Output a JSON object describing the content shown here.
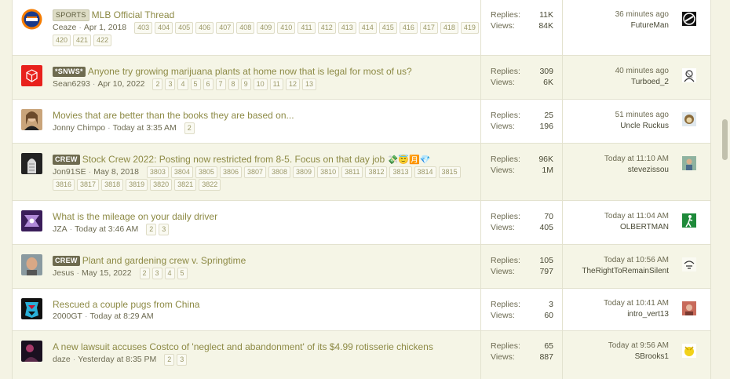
{
  "labels": {
    "replies": "Replies:",
    "views": "Views:"
  },
  "threads": [
    {
      "prefix": "SPORTS",
      "prefix_style": "sports",
      "title": "MLB Official Thread",
      "author": "Ceaze",
      "date": "Apr 1, 2018",
      "pages": [
        "403",
        "404",
        "405",
        "406",
        "407",
        "408",
        "409",
        "410",
        "411",
        "412",
        "413",
        "414",
        "415",
        "416",
        "417",
        "418",
        "419"
      ],
      "pages2": [
        "420",
        "421",
        "422"
      ],
      "replies": "11K",
      "views": "84K",
      "last_time": "36 minutes ago",
      "last_user": "FutureMan",
      "avatar_icon": "mets-logo-icon",
      "last_avatar_icon": "circle-logo-icon"
    },
    {
      "prefix": "*SNWS*",
      "prefix_style": "dark",
      "title": "Anyone try growing marijuana plants at home now that is legal for most of us?",
      "author": "Sean6293",
      "date": "Apr 10, 2022",
      "pages": [
        "2",
        "3",
        "4",
        "5",
        "6",
        "7",
        "8",
        "9",
        "10",
        "11",
        "12",
        "13"
      ],
      "pages2": [],
      "replies": "309",
      "views": "6K",
      "last_time": "40 minutes ago",
      "last_user": "Turboed_2",
      "avatar_icon": "red-cube-icon",
      "last_avatar_icon": "sketch-avatar-icon"
    },
    {
      "prefix": "",
      "prefix_style": "",
      "title": "Movies that are better than the books they are based on...",
      "author": "Jonny Chimpo",
      "date": "Today at 3:35 AM",
      "pages": [
        "2"
      ],
      "pages2": [],
      "replies": "25",
      "views": "196",
      "last_time": "51 minutes ago",
      "last_user": "Uncle Ruckus",
      "avatar_icon": "person-photo-icon",
      "last_avatar_icon": "cartoon-face-icon"
    },
    {
      "prefix": "CREW",
      "prefix_style": "dark",
      "title": "Stock Crew 2022: Posting now restricted from 8-5. Focus on that day job",
      "emoji": "💸😇🈷️💎",
      "author": "Jon91SE",
      "date": "May 8, 2018",
      "pages": [
        "3803",
        "3804",
        "3805",
        "3806",
        "3807",
        "3808",
        "3809",
        "3810",
        "3811",
        "3812",
        "3813",
        "3814",
        "3815"
      ],
      "pages2": [
        "3816",
        "3817",
        "3818",
        "3819",
        "3820",
        "3821",
        "3822"
      ],
      "replies": "96K",
      "views": "1M",
      "last_time": "Today at 11:10 AM",
      "last_user": "stevezissou",
      "avatar_icon": "statue-photo-icon",
      "last_avatar_icon": "person-photo-icon"
    },
    {
      "prefix": "",
      "prefix_style": "",
      "title": "What is the mileage on your daily driver",
      "author": "JZA",
      "date": "Today at 3:46 AM",
      "pages": [
        "2",
        "3"
      ],
      "pages2": [],
      "replies": "70",
      "views": "405",
      "last_time": "Today at 11:04 AM",
      "last_user": "OLBERTMAN",
      "avatar_icon": "purple-logo-icon",
      "last_avatar_icon": "green-figure-icon"
    },
    {
      "prefix": "CREW",
      "prefix_style": "dark",
      "title": "Plant and gardening crew v. Springtime",
      "author": "Jesus",
      "date": "May 15, 2022",
      "pages": [
        "2",
        "3",
        "4",
        "5"
      ],
      "pages2": [],
      "replies": "105",
      "views": "797",
      "last_time": "Today at 10:56 AM",
      "last_user": "TheRightToRemainSilent",
      "avatar_icon": "man-photo-icon",
      "last_avatar_icon": "sketch-avatar-icon"
    },
    {
      "prefix": "",
      "prefix_style": "",
      "title": "Rescued a couple pugs from China",
      "author": "2000GT",
      "date": "Today at 8:29 AM",
      "pages": [],
      "pages2": [],
      "replies": "3",
      "views": "60",
      "last_time": "Today at 10:41 AM",
      "last_user": "intro_vert13",
      "avatar_icon": "transformer-logo-icon",
      "last_avatar_icon": "person-photo-icon"
    },
    {
      "prefix": "",
      "prefix_style": "",
      "title": "A new lawsuit accuses Costco of 'neglect and abandonment' of its $4.99 rotisserie chickens",
      "author": "daze",
      "date": "Yesterday at 8:35 PM",
      "pages": [
        "2",
        "3"
      ],
      "pages2": [],
      "replies": "65",
      "views": "887",
      "last_time": "Today at 9:56 AM",
      "last_user": "SBrooks1",
      "avatar_icon": "dark-photo-icon",
      "last_avatar_icon": "yellow-bird-icon"
    }
  ]
}
